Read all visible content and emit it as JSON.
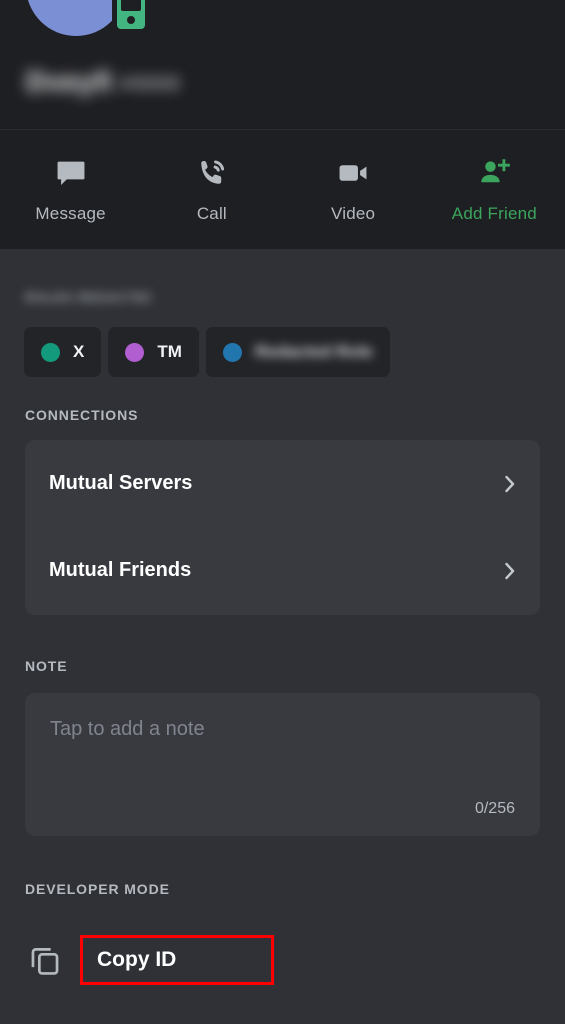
{
  "profile": {
    "username": "Dveyfi",
    "discriminator": "#0000",
    "avatar_color": "#7b8fd4",
    "status": "mobile-online",
    "status_color": "#43b581"
  },
  "actions": [
    {
      "label": "Message",
      "icon": "message-icon",
      "accent": false
    },
    {
      "label": "Call",
      "icon": "call-icon",
      "accent": false
    },
    {
      "label": "Video",
      "icon": "video-icon",
      "accent": false
    },
    {
      "label": "Add Friend",
      "icon": "add-friend-icon",
      "accent": true
    }
  ],
  "roles": {
    "section_label": "ROLES REDACTED",
    "badges": [
      {
        "label": "X",
        "dot_color": "#139a7c",
        "blurred": false
      },
      {
        "label": "TM",
        "dot_color": "#b05ed0",
        "blurred": false
      },
      {
        "label": "Redacted Role",
        "dot_color": "#2176ae",
        "blurred": true
      }
    ]
  },
  "connections": {
    "header": "CONNECTIONS",
    "rows": [
      {
        "label": "Mutual Servers",
        "chevron": "chevron-right-icon"
      },
      {
        "label": "Mutual Friends",
        "chevron": "chevron-right-icon"
      }
    ]
  },
  "note": {
    "header": "NOTE",
    "placeholder": "Tap to add a note",
    "value": "",
    "counter": "0/256"
  },
  "developer_mode": {
    "header": "DEVELOPER MODE",
    "copy_id_label": "Copy ID",
    "icon": "copy-icon",
    "highlight_color": "#ff0000"
  },
  "theme": {
    "header_bg": "#1e1f22",
    "body_bg": "#2f3136",
    "card_bg": "#383a40",
    "badge_bg": "#232428",
    "accent_green": "#3ba55d",
    "muted_text": "#b5bac1",
    "primary_text": "#ffffff"
  }
}
